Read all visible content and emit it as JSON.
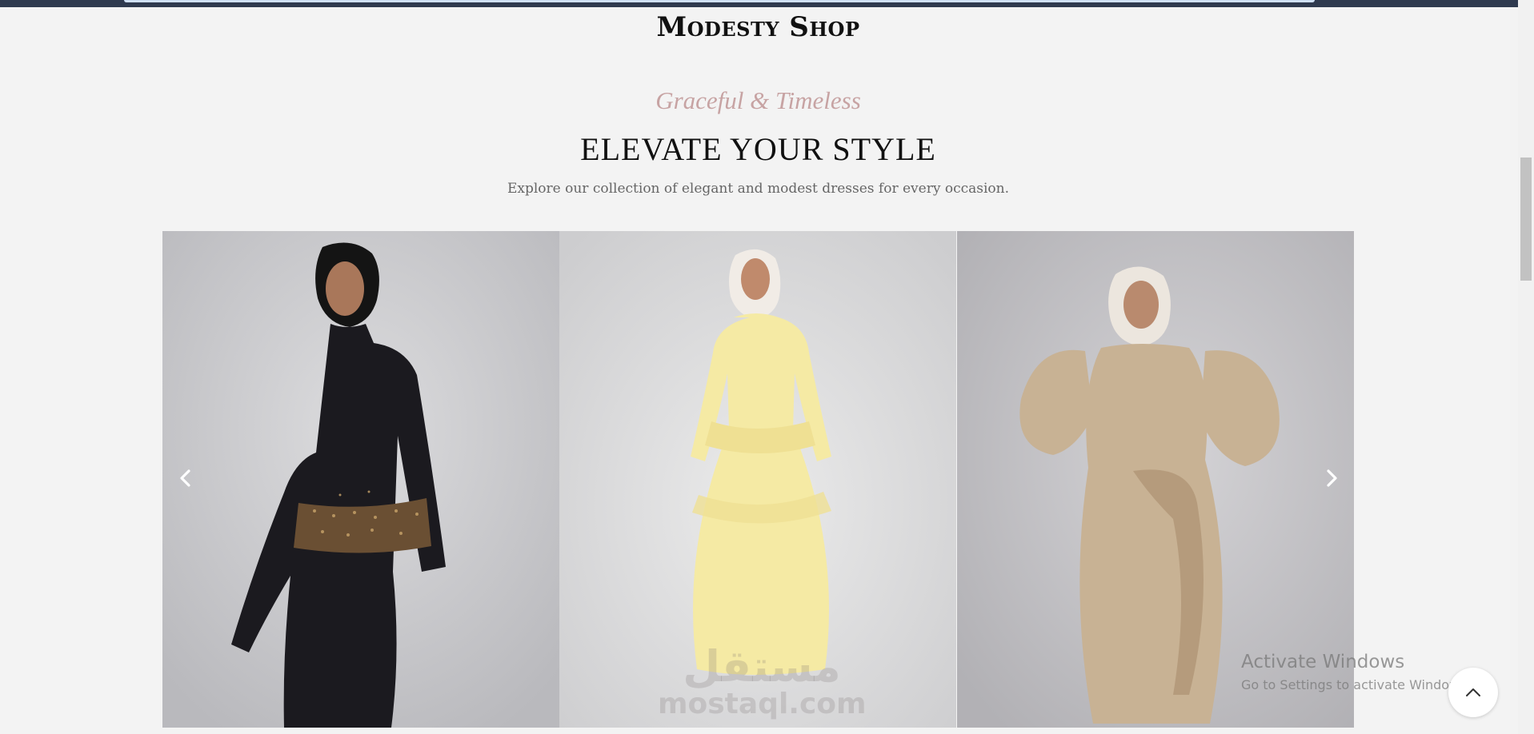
{
  "brand": {
    "title": "Modesty Shop"
  },
  "hero": {
    "eyebrow": "Graceful & Timeless",
    "headline": "ELEVATE YOUR STYLE",
    "subline": "Explore our collection of elegant and modest dresses for every occasion."
  },
  "carousel": {
    "prev_icon": "chevron-left-icon",
    "next_icon": "chevron-right-icon",
    "slides": [
      {
        "dress_color": "#1b1a1f",
        "accent": "#6a4f33",
        "hijab": "#141414"
      },
      {
        "dress_color": "#f5eaa4",
        "accent": "#efe093",
        "hijab": "#f1ece6"
      },
      {
        "dress_color": "#c8b294",
        "accent": "#b59b7c",
        "hijab": "#ece6de"
      }
    ]
  },
  "watermark": {
    "arabic": "مستقل",
    "latin": "mostaql.com"
  },
  "os_overlay": {
    "title": "Activate Windows",
    "subtitle": "Go to Settings to activate Windows."
  },
  "scroll_top": {
    "icon": "chevron-up-icon"
  },
  "colors": {
    "background": "#f3f3f3",
    "eyebrow": "#c7a3a3",
    "topbar": "#2f3a4f"
  }
}
